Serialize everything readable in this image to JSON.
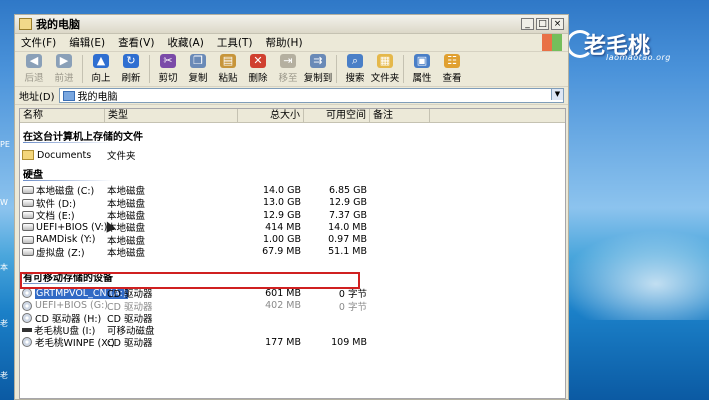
{
  "window": {
    "title": "我的电脑",
    "controls": {
      "minimize": "_",
      "maximize": "□",
      "close": "×"
    }
  },
  "menu": [
    "文件(F)",
    "编辑(E)",
    "查看(V)",
    "收藏(A)",
    "工具(T)",
    "帮助(H)"
  ],
  "toolbar": [
    {
      "label": "后退",
      "icon": "back-icon",
      "color": "#8aa0b8",
      "disabled": true
    },
    {
      "label": "前进",
      "icon": "forward-icon",
      "color": "#8aa0b8",
      "disabled": true
    },
    {
      "label": "向上",
      "icon": "up-icon",
      "color": "#2f6fd1",
      "disabled": false
    },
    {
      "label": "刷新",
      "icon": "refresh-icon",
      "color": "#2f6fd1",
      "disabled": false
    },
    {
      "label": "剪切",
      "icon": "cut-icon",
      "color": "#7b4aa8",
      "disabled": false
    },
    {
      "label": "复制",
      "icon": "copy-icon",
      "color": "#6a8ab7",
      "disabled": false
    },
    {
      "label": "粘贴",
      "icon": "paste-icon",
      "color": "#c7953a",
      "disabled": false
    },
    {
      "label": "删除",
      "icon": "delete-icon",
      "color": "#d04030",
      "disabled": false
    },
    {
      "label": "移至",
      "icon": "move-to-icon",
      "color": "#b5b0a0",
      "disabled": true
    },
    {
      "label": "复制到",
      "icon": "copy-to-icon",
      "color": "#6a8ab7",
      "disabled": false
    },
    {
      "label": "搜索",
      "icon": "search-icon",
      "color": "#4a7fc7",
      "disabled": false
    },
    {
      "label": "文件夹",
      "icon": "folders-icon",
      "color": "#e5b84a",
      "disabled": false
    },
    {
      "label": "属性",
      "icon": "properties-icon",
      "color": "#4a7fc7",
      "disabled": false
    },
    {
      "label": "查看",
      "icon": "views-icon",
      "color": "#e0a030",
      "disabled": false
    }
  ],
  "address": {
    "label": "地址(D)",
    "value": "我的电脑"
  },
  "columns": {
    "name": "名称",
    "type": "类型",
    "total": "总大小",
    "free": "可用空间",
    "note": "备注"
  },
  "groups": [
    {
      "title": "在这台计算机上存储的文件",
      "items": [
        {
          "icon": "folder",
          "name": "Documents",
          "type": "文件夹",
          "total": "",
          "free": ""
        }
      ]
    },
    {
      "title": "硬盘",
      "items": [
        {
          "icon": "drive",
          "name": "本地磁盘 (C:)",
          "type": "本地磁盘",
          "total": "14.0 GB",
          "free": "6.85 GB"
        },
        {
          "icon": "drive",
          "name": "软件 (D:)",
          "type": "本地磁盘",
          "total": "13.0 GB",
          "free": "12.9 GB"
        },
        {
          "icon": "drive",
          "name": "文档 (E:)",
          "type": "本地磁盘",
          "total": "12.9 GB",
          "free": "7.37 GB"
        },
        {
          "icon": "drive",
          "name": "UEFI+BIOS (V:)",
          "type": "本地磁盘",
          "total": "414 MB",
          "free": "14.0 MB"
        },
        {
          "icon": "drive",
          "name": "RAMDisk (Y:)",
          "type": "本地磁盘",
          "total": "1.00 GB",
          "free": "0.97 MB"
        },
        {
          "icon": "drive",
          "name": "虚拟盘 (Z:)",
          "type": "本地磁盘",
          "total": "67.9 MB",
          "free": "51.1 MB"
        }
      ]
    },
    {
      "title": "有可移动存储的设备",
      "items": [
        {
          "icon": "cd",
          "name": "GRTMPVOL_CN (A:)",
          "type": "CD 驱动器",
          "total": "601 MB",
          "free": "0 字节",
          "selected": true
        },
        {
          "icon": "cd",
          "name": "UEFI+BIOS (G:)",
          "type": "CD 驱动器",
          "total": "402 MB",
          "free": "0 字节",
          "faded": true
        },
        {
          "icon": "cd",
          "name": "CD 驱动器 (H:)",
          "type": "CD 驱动器",
          "total": "",
          "free": ""
        },
        {
          "icon": "usb",
          "name": "老毛桃U盘 (I:)",
          "type": "可移动磁盘",
          "total": "",
          "free": ""
        },
        {
          "icon": "cd",
          "name": "老毛桃WINPE (X:)",
          "type": "CD 驱动器",
          "total": "177 MB",
          "free": "109 MB"
        }
      ]
    }
  ],
  "logo": {
    "text": "老毛桃",
    "url": "laomaotao.org"
  },
  "desktop_labels": [
    "PE",
    "W",
    "本",
    "老",
    "老"
  ]
}
